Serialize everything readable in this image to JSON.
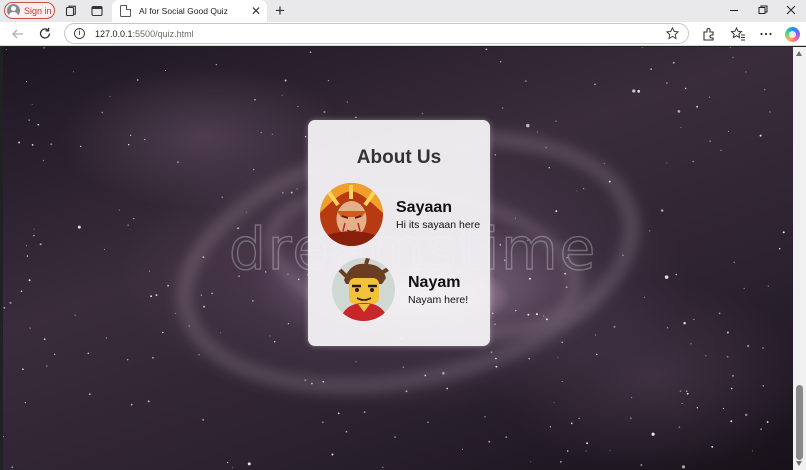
{
  "browser": {
    "signin_label": "Sign in",
    "tab": {
      "title": "AI for Social Good Quiz",
      "favicon": "page-icon"
    },
    "url": {
      "host": "127.0.0.1",
      "path": ":5500/quiz.html"
    },
    "icons": [
      "workspaces-icon",
      "tab-actions-icon",
      "close-icon",
      "plus-icon",
      "minimize-icon",
      "restore-icon",
      "window-close-icon",
      "back-icon",
      "reload-icon",
      "info-icon",
      "star-icon",
      "extensions-icon",
      "favorites-icon",
      "more-icon",
      "copilot-icon"
    ]
  },
  "page": {
    "background_watermark": "dreamstime",
    "about": {
      "title": "About Us",
      "members": [
        {
          "name": "Sayaan",
          "description": "Hi its sayaan here",
          "avatar": "fire-warrior-avatar"
        },
        {
          "name": "Nayam",
          "description": "Nayam here!",
          "avatar": "lego-ninja-avatar"
        }
      ]
    }
  },
  "colors": {
    "signin_accent": "#c5504f",
    "card_background": "#f2f0f4",
    "title_text": "#333333"
  }
}
